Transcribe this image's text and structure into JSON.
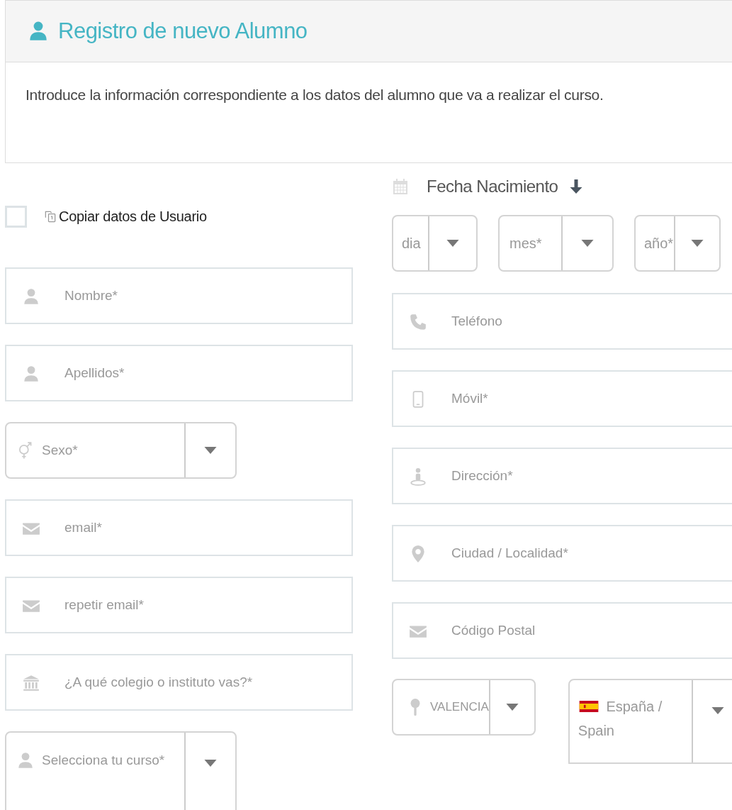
{
  "header": {
    "title": "Registro de nuevo Alumno"
  },
  "intro": "Introduce la información correspondiente a los datos del alumno que va a realizar el curso.",
  "copy_user": {
    "label": "Copiar datos de Usuario",
    "checked": false
  },
  "left_fields": [
    {
      "kind": "input",
      "placeholder": "Nombre*"
    },
    {
      "kind": "input",
      "placeholder": "Apellidos*"
    },
    {
      "kind": "select",
      "placeholder": "Sexo*"
    },
    {
      "kind": "input",
      "placeholder": "email*"
    },
    {
      "kind": "input",
      "placeholder": "repetir email*"
    },
    {
      "kind": "input",
      "placeholder": "¿A qué colegio o instituto vas?*"
    },
    {
      "kind": "select",
      "placeholder": "Selecciona tu curso*"
    }
  ],
  "birth_date": {
    "label": "Fecha Nacimiento",
    "selects": [
      {
        "placeholder": "dia"
      },
      {
        "placeholder": "mes*"
      },
      {
        "placeholder": "año*"
      }
    ]
  },
  "right_fields": [
    {
      "kind": "input",
      "placeholder": "Teléfono"
    },
    {
      "kind": "input",
      "placeholder": "Móvil*"
    },
    {
      "kind": "input",
      "placeholder": "Dirección*"
    },
    {
      "kind": "input",
      "placeholder": "Ciudad / Localidad*"
    },
    {
      "kind": "input",
      "placeholder": "Código Postal"
    }
  ],
  "region": {
    "value": "VALENCIA"
  },
  "country": {
    "value": "España / Spain"
  }
}
